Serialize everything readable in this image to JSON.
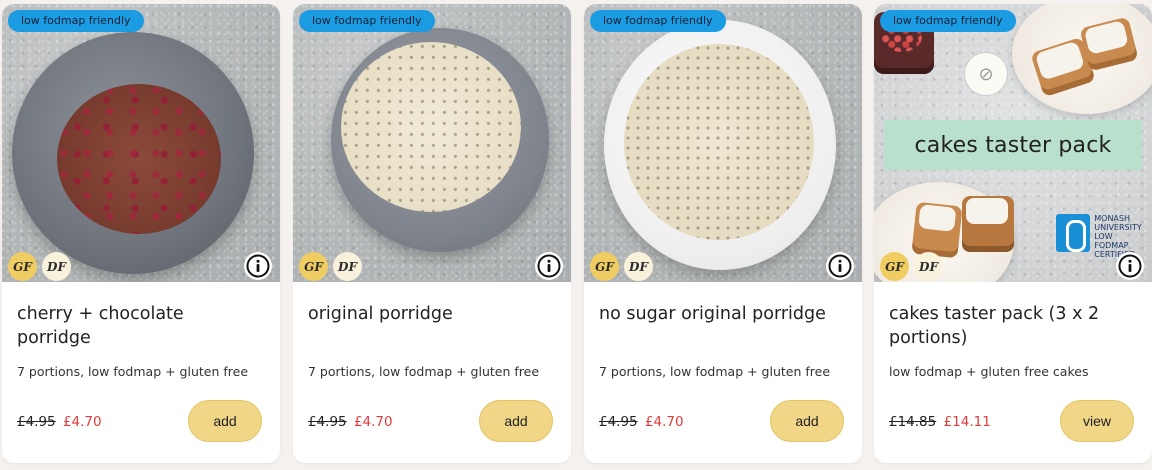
{
  "products": [
    {
      "pill": "low fodmap friendly",
      "badges": [
        "GF",
        "DF"
      ],
      "title": "cherry + chocolate porridge",
      "subtitle": "7 portions, low fodmap + gluten free",
      "price_old": "£4.95",
      "price_new": "£4.70",
      "action": "add",
      "icon": "info-icon"
    },
    {
      "pill": "low fodmap friendly",
      "badges": [
        "GF",
        "DF"
      ],
      "title": "original porridge",
      "subtitle": "7 portions, low fodmap + gluten free",
      "price_old": "£4.95",
      "price_new": "£4.70",
      "action": "add",
      "icon": "info-icon"
    },
    {
      "pill": "low fodmap friendly",
      "badges": [
        "GF",
        "DF"
      ],
      "title": "no sugar original porridge",
      "subtitle": "7 portions, low fodmap + gluten free",
      "price_old": "£4.95",
      "price_new": "£4.70",
      "action": "add",
      "icon": "info-icon"
    },
    {
      "pill": "low fodmap friendly",
      "badges": [
        "GF",
        "DF"
      ],
      "title": "cakes taster pack (3 x 2 portions)",
      "subtitle": "low fodmap + gluten free cakes",
      "price_old": "£14.85",
      "price_new": "£14.11",
      "action": "view",
      "icon": "info-icon",
      "image_banner": "cakes taster pack",
      "image_logo_text": [
        "MONASH",
        "UNIVERSITY",
        "LOW FODMAP",
        "CERTIFIED"
      ]
    }
  ],
  "colors": {
    "pill_bg": "#1b9be1",
    "gf_badge": "#f0cd62",
    "df_badge": "#f8f2dc",
    "button_bg": "#f0d686",
    "sale_price": "#e23b3b",
    "banner_bg": "#b9dfcd"
  }
}
